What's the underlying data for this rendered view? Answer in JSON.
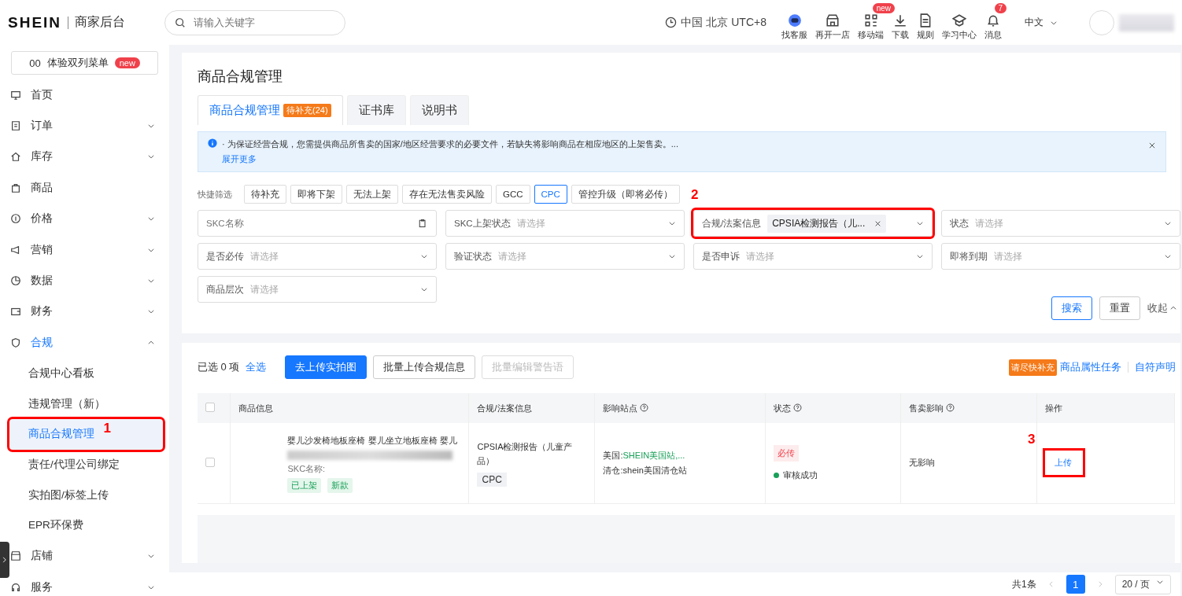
{
  "header": {
    "logo": "SHEIN",
    "app_name": "商家后台",
    "search": {
      "placeholder": "请输入关键字"
    },
    "timezone": "中国 北京 UTC+8",
    "tools": [
      {
        "label": "找客服"
      },
      {
        "label": "再开一店"
      },
      {
        "label": "移动端",
        "badge": "new"
      },
      {
        "label": "下载"
      },
      {
        "label": "规则"
      },
      {
        "label": "学习中心"
      },
      {
        "label": "消息",
        "badge": "7"
      }
    ],
    "language": "中文"
  },
  "sidebar": {
    "promo": {
      "icon_text": "00",
      "label": "体验双列菜单",
      "badge": "new"
    },
    "items": [
      {
        "kind": "link",
        "label": "首页"
      },
      {
        "kind": "group",
        "label": "订单",
        "expanded": false
      },
      {
        "kind": "group",
        "label": "库存",
        "expanded": false
      },
      {
        "kind": "link",
        "label": "商品"
      },
      {
        "kind": "group",
        "label": "价格",
        "expanded": false
      },
      {
        "kind": "group",
        "label": "营销",
        "expanded": false
      },
      {
        "kind": "group",
        "label": "数据",
        "expanded": false
      },
      {
        "kind": "group",
        "label": "财务",
        "expanded": false
      },
      {
        "kind": "group",
        "label": "合规",
        "expanded": true,
        "children": [
          {
            "label": "合规中心看板",
            "selected": false
          },
          {
            "label": "违规管理（新）",
            "selected": false
          },
          {
            "label": "商品合规管理",
            "selected": true,
            "annotation": "1"
          },
          {
            "label": "责任/代理公司绑定",
            "selected": false
          },
          {
            "label": "实拍图/标签上传",
            "selected": false
          },
          {
            "label": "EPR环保费",
            "selected": false
          }
        ]
      },
      {
        "kind": "group",
        "label": "店铺",
        "expanded": false
      },
      {
        "kind": "group",
        "label": "服务",
        "expanded": false
      }
    ]
  },
  "page": {
    "title": "商品合规管理",
    "tabs": [
      {
        "label": "商品合规管理",
        "badge": "待补充(24)",
        "selected": true
      },
      {
        "label": "证书库",
        "selected": false
      },
      {
        "label": "说明书",
        "selected": false
      }
    ],
    "notice": {
      "text": "· 为保证经营合规，您需提供商品所售卖的国家/地区经营要求的必要文件，若缺失将影响商品在相应地区的上架售卖。...",
      "link": "展开更多"
    },
    "quick_filters": {
      "label": "快捷筛选",
      "chips": [
        {
          "label": "待补充",
          "selected": false
        },
        {
          "label": "即将下架",
          "selected": false
        },
        {
          "label": "无法上架",
          "selected": false
        },
        {
          "label": "存在无法售卖风险",
          "selected": false
        },
        {
          "label": "GCC",
          "selected": false
        },
        {
          "label": "CPC",
          "selected": true
        },
        {
          "label": "管控升级（即将必传）",
          "selected": false
        }
      ]
    },
    "filters": [
      {
        "kind": "input",
        "placeholder": "SKC名称"
      },
      {
        "kind": "select",
        "label": "SKC上架状态",
        "placeholder": "请选择"
      },
      {
        "kind": "tags",
        "label": "合规/法案信息",
        "tag": "CPSIA检测报告（儿...",
        "annotation": "2"
      },
      {
        "kind": "select",
        "label": "状态",
        "placeholder": "请选择"
      },
      {
        "kind": "select",
        "label": "是否必传",
        "placeholder": "请选择"
      },
      {
        "kind": "select",
        "label": "验证状态",
        "placeholder": "请选择"
      },
      {
        "kind": "select",
        "label": "是否申诉",
        "placeholder": "请选择"
      },
      {
        "kind": "select",
        "label": "即将到期",
        "placeholder": "请选择"
      },
      {
        "kind": "select",
        "label": "商品层次",
        "placeholder": "请选择"
      }
    ],
    "filter_actions": {
      "search": "搜索",
      "reset": "重置",
      "collapse": "收起"
    },
    "bulk": {
      "selected_text": "已选 0 项",
      "select_all": "全选",
      "buttons": [
        {
          "label": "去上传实拍图",
          "kind": "primary",
          "disabled": false
        },
        {
          "label": "批量上传合规信息",
          "kind": "default",
          "disabled": false
        },
        {
          "label": "批量编辑警告语",
          "kind": "default",
          "disabled": true
        }
      ],
      "hint_badge": "请尽快补充",
      "links": [
        "商品属性任务",
        "自符声明"
      ]
    },
    "table": {
      "all_checked": false,
      "columns": [
        {
          "label": "商品信息",
          "help": false
        },
        {
          "label": "合规/法案信息",
          "help": false
        },
        {
          "label": "影响站点",
          "help": true
        },
        {
          "label": "状态",
          "help": true
        },
        {
          "label": "售卖影响",
          "help": true
        },
        {
          "label": "操作",
          "help": false
        }
      ],
      "rows": [
        {
          "checked": false,
          "title": "婴儿沙发椅地板座椅 婴儿坐立地板座椅 婴儿",
          "skc_label": "SKC名称:",
          "tags": [
            {
              "label": "已上架"
            },
            {
              "label": "新款"
            }
          ],
          "compliance": "CPSIA检测报告（儿童产品）",
          "compliance_tag": "CPC",
          "sites": [
            {
              "label": "美国:",
              "value": "SHEIN美国站,..."
            },
            {
              "label": "清仓:shein美国清仓站"
            }
          ],
          "status_tag": "必传",
          "status": {
            "label": "审核成功",
            "color": "#18a058"
          },
          "impact": "无影响",
          "action": "上传",
          "annotation": "3"
        }
      ]
    },
    "pagination": {
      "total": "共1条",
      "pages": [
        {
          "label": "1",
          "selected": true
        }
      ],
      "page_size": "20 / 页"
    }
  }
}
